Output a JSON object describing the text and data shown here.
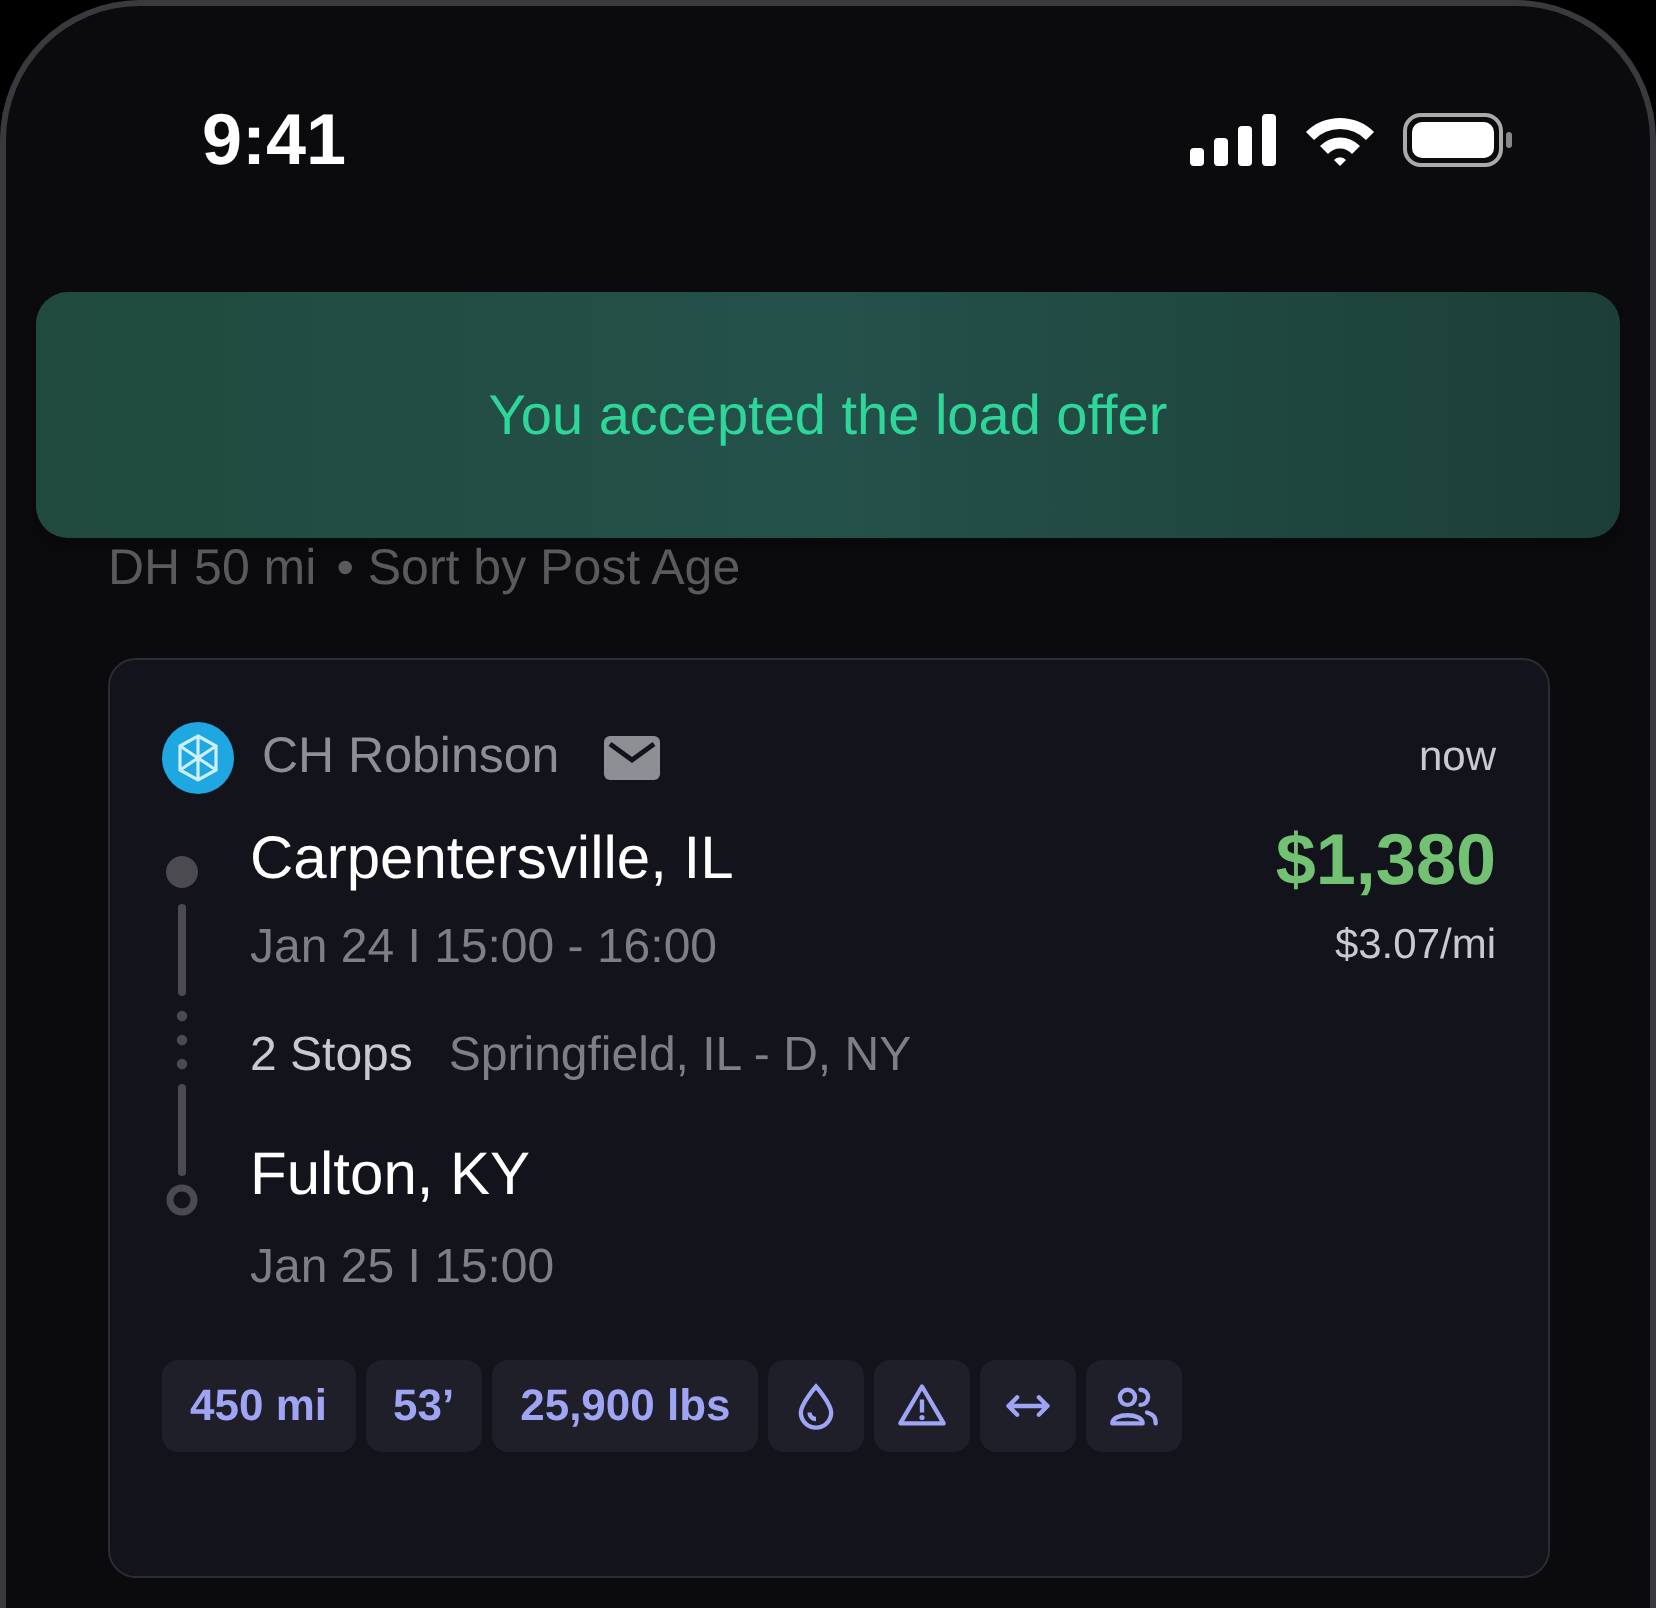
{
  "status_bar": {
    "time": "9:41"
  },
  "toast": {
    "message": "You accepted the load offer"
  },
  "filters": {
    "deadhead": "DH 50 mi",
    "sort": "• Sort by Post Age"
  },
  "load": {
    "broker": "CH Robinson",
    "posted": "now",
    "price": "$1,380",
    "rate": "$3.07/mi",
    "origin": {
      "city": "Carpentersville, IL",
      "time": "Jan 24 I 15:00 - 16:00"
    },
    "stops": {
      "count": "2 Stops",
      "via": "Springfield, IL - D, NY"
    },
    "destination": {
      "city": "Fulton, KY",
      "time": "Jan 25 I 15:00"
    },
    "tags": [
      {
        "kind": "text",
        "label": "450 mi"
      },
      {
        "kind": "text",
        "label": "53’"
      },
      {
        "kind": "text",
        "label": "25,900 lbs"
      },
      {
        "kind": "liquid"
      },
      {
        "kind": "hazmat"
      },
      {
        "kind": "oversize"
      },
      {
        "kind": "team"
      }
    ]
  }
}
